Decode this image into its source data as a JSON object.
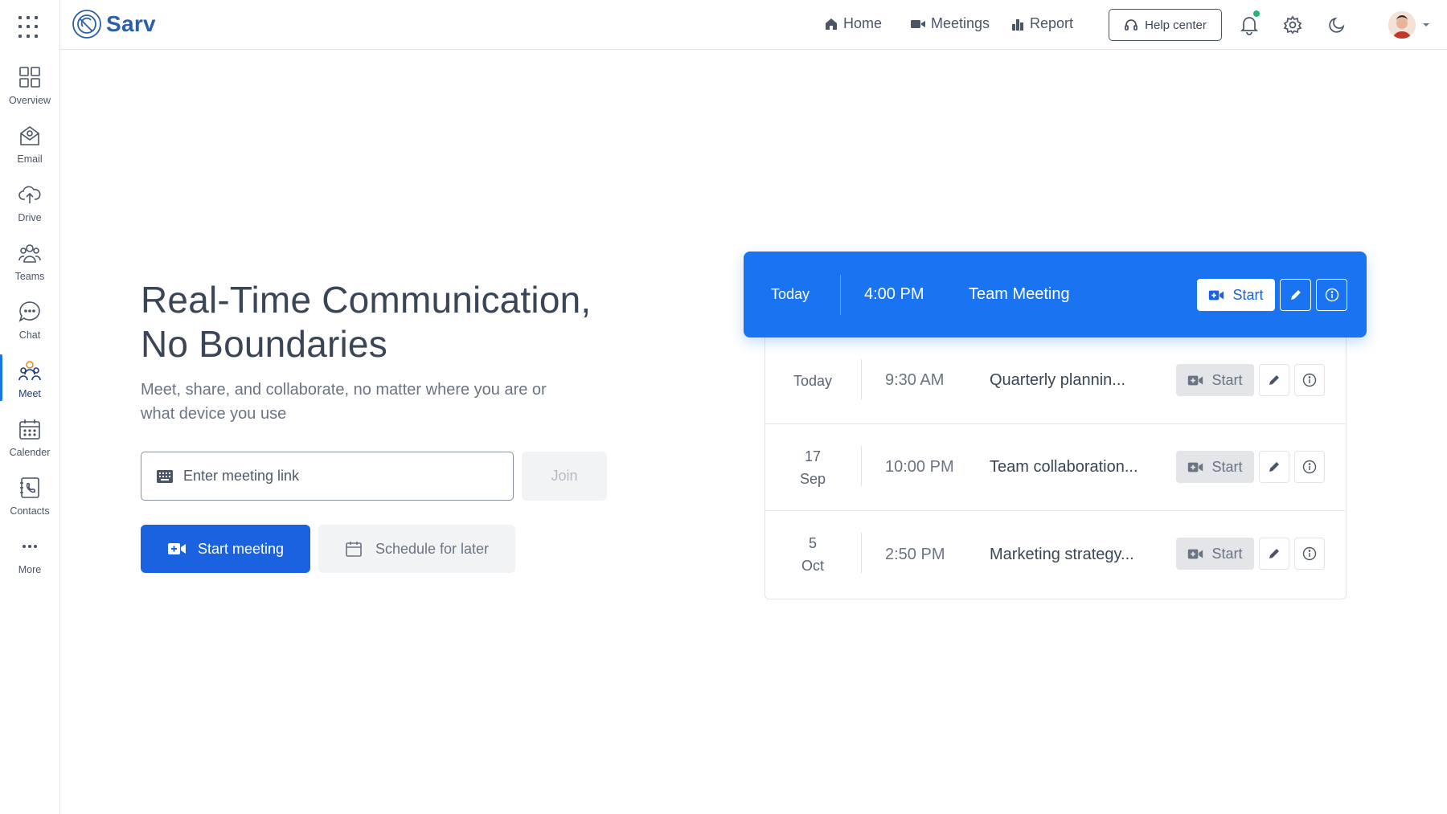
{
  "app": {
    "name": "Sarv"
  },
  "sidebar": {
    "items": [
      {
        "label": "Overview",
        "icon": "overview-icon"
      },
      {
        "label": "Email",
        "icon": "email-icon"
      },
      {
        "label": "Drive",
        "icon": "drive-icon"
      },
      {
        "label": "Teams",
        "icon": "teams-icon"
      },
      {
        "label": "Chat",
        "icon": "chat-icon"
      },
      {
        "label": "Meet",
        "icon": "meet-icon",
        "active": true
      },
      {
        "label": "Calender",
        "icon": "calendar-icon"
      },
      {
        "label": "Contacts",
        "icon": "contacts-icon"
      },
      {
        "label": "More",
        "icon": "more-icon"
      }
    ]
  },
  "topnav": {
    "home": "Home",
    "meetings": "Meetings",
    "report": "Report",
    "help": "Help center"
  },
  "hero": {
    "title_line1": "Real-Time Communication,",
    "title_line2": "No Boundaries",
    "subtitle": "Meet, share, and collaborate, no matter where you are or what device you use",
    "link_placeholder": "Enter meeting link",
    "join": "Join",
    "start_meeting": "Start meeting",
    "schedule": "Schedule for later"
  },
  "featured_meeting": {
    "date": "Today",
    "time": "4:00 PM",
    "title": "Team Meeting",
    "start": "Start"
  },
  "meetings": [
    {
      "date_line1": "Today",
      "date_line2": "",
      "time": "9:30 AM",
      "title": "Quarterly plannin...",
      "start": "Start"
    },
    {
      "date_line1": "17",
      "date_line2": "Sep",
      "time": "10:00 PM",
      "title": "Team collaboration...",
      "start": "Start"
    },
    {
      "date_line1": "5",
      "date_line2": "Oct",
      "time": "2:50 PM",
      "title": "Marketing strategy...",
      "start": "Start"
    }
  ],
  "colors": {
    "primary": "#1a62e0",
    "featured": "#1a73f0",
    "brand": "#2b5fa8",
    "status_online": "#22b573"
  }
}
